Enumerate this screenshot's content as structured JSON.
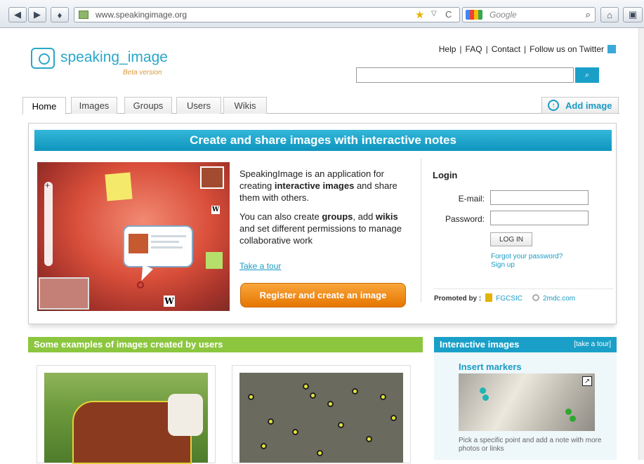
{
  "browser": {
    "url": "www.speakingimage.org",
    "search_placeholder": "Google",
    "icons": [
      "back-arrow",
      "forward-arrow",
      "bookmark-star",
      "dropdown",
      "reload",
      "magnifier",
      "home"
    ]
  },
  "header": {
    "logo_text": "speaking_image",
    "logo_beta": "Beta version",
    "links": [
      "Help",
      "FAQ",
      "Contact",
      "Follow us on Twitter"
    ],
    "search_button": "🔍"
  },
  "tabs": [
    "Home",
    "Images",
    "Groups",
    "Users",
    "Wikis"
  ],
  "add_image": "Add image",
  "hero": {
    "title": "Create and share images with interactive notes",
    "intro_1_pre": "SpeakingImage is an application for creating ",
    "intro_1_bold": "interactive images",
    "intro_1_post": " and share them with others.",
    "intro_2_pre": "You can also create ",
    "intro_2_bold1": "groups",
    "intro_2_mid": ", add ",
    "intro_2_bold2": "wikis",
    "intro_2_post": " and set different permissions to manage collaborative work",
    "tour_link": "Take a tour",
    "register_button": "Register and create an image"
  },
  "login": {
    "title": "Login",
    "email_label": "E-mail:",
    "password_label": "Password:",
    "button": "LOG IN",
    "forgot": "Forgot your password?",
    "signup": "Sign up"
  },
  "promoted": {
    "label": "Promoted by :",
    "org1": "FGCSIC",
    "org2": "2mdc.com"
  },
  "examples": {
    "title": "Some examples of images created by users"
  },
  "interactive": {
    "title": "Interactive images",
    "take_tour": "[take a tour]",
    "insert_title": "Insert markers",
    "insert_desc": "Pick a specific point and add a note with more photos or links"
  },
  "colors": {
    "brand_blue": "#1aa0c8",
    "orange": "#f28c1c",
    "green": "#8cc63f"
  }
}
